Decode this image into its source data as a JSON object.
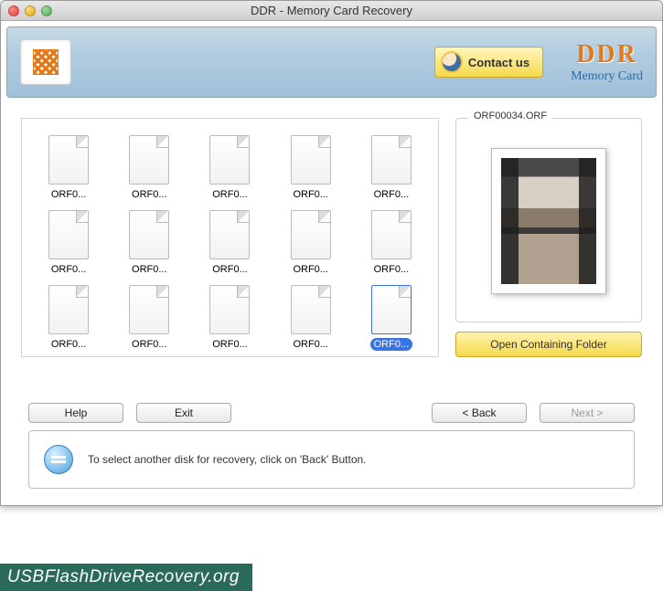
{
  "window": {
    "title": "DDR - Memory Card Recovery"
  },
  "header": {
    "contact_label": "Contact us",
    "brand_title": "DDR",
    "brand_subtitle": "Memory Card"
  },
  "files": [
    {
      "label": "ORF0...",
      "selected": false
    },
    {
      "label": "ORF0...",
      "selected": false
    },
    {
      "label": "ORF0...",
      "selected": false
    },
    {
      "label": "ORF0...",
      "selected": false
    },
    {
      "label": "ORF0...",
      "selected": false
    },
    {
      "label": "ORF0...",
      "selected": false
    },
    {
      "label": "ORF0...",
      "selected": false
    },
    {
      "label": "ORF0...",
      "selected": false
    },
    {
      "label": "ORF0...",
      "selected": false
    },
    {
      "label": "ORF0...",
      "selected": false
    },
    {
      "label": "ORF0...",
      "selected": false
    },
    {
      "label": "ORF0...",
      "selected": false
    },
    {
      "label": "ORF0...",
      "selected": false
    },
    {
      "label": "ORF0...",
      "selected": false
    },
    {
      "label": "ORF0...",
      "selected": true
    }
  ],
  "preview": {
    "filename": "ORF00034.ORF",
    "open_folder_label": "Open Containing Folder"
  },
  "buttons": {
    "help": "Help",
    "exit": "Exit",
    "back": "< Back",
    "next": "Next >"
  },
  "hint": {
    "text": "To select another disk for recovery, click on 'Back' Button."
  },
  "footer": {
    "url": "USBFlashDriveRecovery.org"
  }
}
